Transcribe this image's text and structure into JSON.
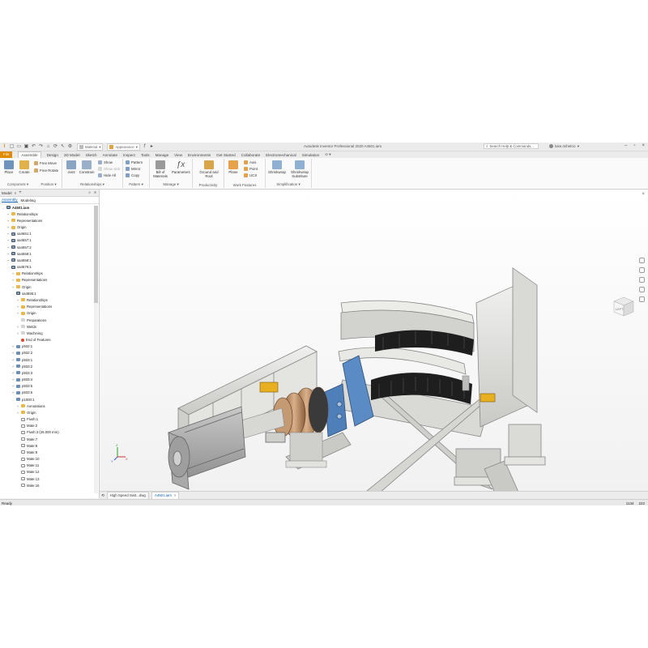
{
  "app": {
    "window_title": "Autodesk Inventor Professional 2020   A4501.iam",
    "material_dropdown": "Material",
    "appearance_dropdown": "Appearance",
    "search_placeholder": "Search Help & Commands...",
    "user_name": "luke.mihelcic"
  },
  "ribbon": {
    "tabs": [
      "File",
      "Assemble",
      "Design",
      "3D Model",
      "Sketch",
      "Annotate",
      "Inspect",
      "Tools",
      "Manage",
      "View",
      "Environments",
      "Get Started",
      "Collaborate",
      "Electromechanical",
      "Simulation"
    ],
    "active_tab": "Assemble",
    "panels": {
      "component": {
        "label": "Component",
        "place": "Place",
        "create": "Create",
        "free_move": "Free Move",
        "free_rotate": "Free Rotate"
      },
      "position": {
        "label": "Position"
      },
      "relationships": {
        "label": "Relationships",
        "joint": "Joint",
        "constrain": "Constrain",
        "show": "Show",
        "show_sick": "Show Sick",
        "hide_all": "Hide All"
      },
      "pattern": {
        "label": "Pattern",
        "pattern": "Pattern",
        "mirror": "Mirror",
        "copy": "Copy"
      },
      "manage": {
        "label": "Manage",
        "bom_line1": "Bill of",
        "bom_line2": "Materials",
        "parameters": "Parameters"
      },
      "productivity": {
        "label": "Productivity",
        "ground_line1": "Ground and",
        "ground_line2": "Root"
      },
      "work_features": {
        "label": "Work Features",
        "plane": "Plane",
        "axis": "Axis",
        "point": "Point",
        "ucs": "UCS"
      },
      "simplification": {
        "label": "Simplification",
        "shrinkwrap": "Shrinkwrap",
        "sub_line1": "Shrinkwrap",
        "sub_line2": "Substitute"
      }
    }
  },
  "browser": {
    "title": "Model",
    "tabs": [
      "Assembly",
      "Modeling"
    ],
    "active_tab": "Assembly",
    "tree": [
      {
        "label": "A4501.iam",
        "level": 0,
        "icon": "assembly",
        "expander": "-",
        "bold": true
      },
      {
        "label": "Relationships",
        "level": 1,
        "icon": "folder",
        "expander": "+"
      },
      {
        "label": "Representations",
        "level": 1,
        "icon": "folder",
        "expander": "+"
      },
      {
        "label": "Origin",
        "level": 1,
        "icon": "folder",
        "expander": "+"
      },
      {
        "label": "sa4651:1",
        "level": 1,
        "icon": "assembly",
        "expander": "+"
      },
      {
        "label": "sa4657:1",
        "level": 1,
        "icon": "assembly",
        "expander": "+"
      },
      {
        "label": "sa4657:2",
        "level": 1,
        "icon": "assembly",
        "expander": "+"
      },
      {
        "label": "sa4659:1",
        "level": 1,
        "icon": "assembly",
        "expander": "+"
      },
      {
        "label": "sa4659:1",
        "level": 1,
        "icon": "assembly",
        "expander": "+"
      },
      {
        "label": "sa4676:1",
        "level": 1,
        "icon": "assembly",
        "expander": "-"
      },
      {
        "label": "Relationships",
        "level": 2,
        "icon": "folder",
        "expander": "+"
      },
      {
        "label": "Representations",
        "level": 2,
        "icon": "folder",
        "expander": "+"
      },
      {
        "label": "Origin",
        "level": 2,
        "icon": "folder",
        "expander": "+"
      },
      {
        "label": "sa4655:1",
        "level": 2,
        "icon": "assembly",
        "expander": "-"
      },
      {
        "label": "Relationships",
        "level": 3,
        "icon": "folder",
        "expander": "+"
      },
      {
        "label": "Representations",
        "level": 3,
        "icon": "folder",
        "expander": "+"
      },
      {
        "label": "Origin",
        "level": 3,
        "icon": "folder",
        "expander": "+"
      },
      {
        "label": "Preparations",
        "level": 3,
        "icon": "feature",
        "expander": ""
      },
      {
        "label": "Welds",
        "level": 3,
        "icon": "feature",
        "expander": "+"
      },
      {
        "label": "Machining",
        "level": 3,
        "icon": "feature",
        "expander": "+"
      },
      {
        "label": "End of Features",
        "level": 3,
        "icon": "eof",
        "expander": ""
      },
      {
        "label": "p932:1",
        "level": 2,
        "icon": "part",
        "expander": "+"
      },
      {
        "label": "p932:2",
        "level": 2,
        "icon": "part",
        "expander": "+"
      },
      {
        "label": "p933:1",
        "level": 2,
        "icon": "part",
        "expander": "+"
      },
      {
        "label": "p933:2",
        "level": 2,
        "icon": "part",
        "expander": "+"
      },
      {
        "label": "p933:3",
        "level": 2,
        "icon": "part",
        "expander": "+"
      },
      {
        "label": "p933:4",
        "level": 2,
        "icon": "part",
        "expander": "+"
      },
      {
        "label": "p933:5",
        "level": 2,
        "icon": "part",
        "expander": "+"
      },
      {
        "label": "p933:6",
        "level": 2,
        "icon": "part",
        "expander": "+"
      },
      {
        "label": "p1000:1",
        "level": 2,
        "icon": "part",
        "expander": "-"
      },
      {
        "label": "Annotations",
        "level": 3,
        "icon": "folder",
        "expander": "+"
      },
      {
        "label": "Origin",
        "level": 3,
        "icon": "folder",
        "expander": "+"
      },
      {
        "label": "Flush:1",
        "level": 3,
        "icon": "constraint",
        "expander": ""
      },
      {
        "label": "Mate:2",
        "level": 3,
        "icon": "constraint",
        "expander": ""
      },
      {
        "label": "Flush:3 (26.000 mm)",
        "level": 3,
        "icon": "constraint",
        "expander": ""
      },
      {
        "label": "Mate:7",
        "level": 3,
        "icon": "constraint",
        "expander": ""
      },
      {
        "label": "Mate:8",
        "level": 3,
        "icon": "constraint",
        "expander": ""
      },
      {
        "label": "Mate:9",
        "level": 3,
        "icon": "constraint",
        "expander": ""
      },
      {
        "label": "Mate:10",
        "level": 3,
        "icon": "constraint",
        "expander": ""
      },
      {
        "label": "Mate:11",
        "level": 3,
        "icon": "constraint",
        "expander": ""
      },
      {
        "label": "Mate:12",
        "level": 3,
        "icon": "constraint",
        "expander": ""
      },
      {
        "label": "Mate:13",
        "level": 3,
        "icon": "constraint",
        "expander": ""
      },
      {
        "label": "Mate:16",
        "level": 3,
        "icon": "constraint",
        "expander": ""
      }
    ]
  },
  "viewport": {
    "viewcube_label": "LEFT",
    "triad": {
      "x": "X",
      "y": "Y",
      "z": "Z"
    }
  },
  "doc_tabs": [
    {
      "label": "High Speed Swit...dwg",
      "active": false
    },
    {
      "label": "A4501.iam",
      "active": true
    }
  ],
  "status": {
    "text": "Ready",
    "num1": "1134",
    "num2": "222"
  },
  "colors": {
    "file_tab": "#e08a00",
    "model_blue": "#4f7fb8",
    "bronze": "#b98b63",
    "yellow_part": "#e8b020"
  }
}
